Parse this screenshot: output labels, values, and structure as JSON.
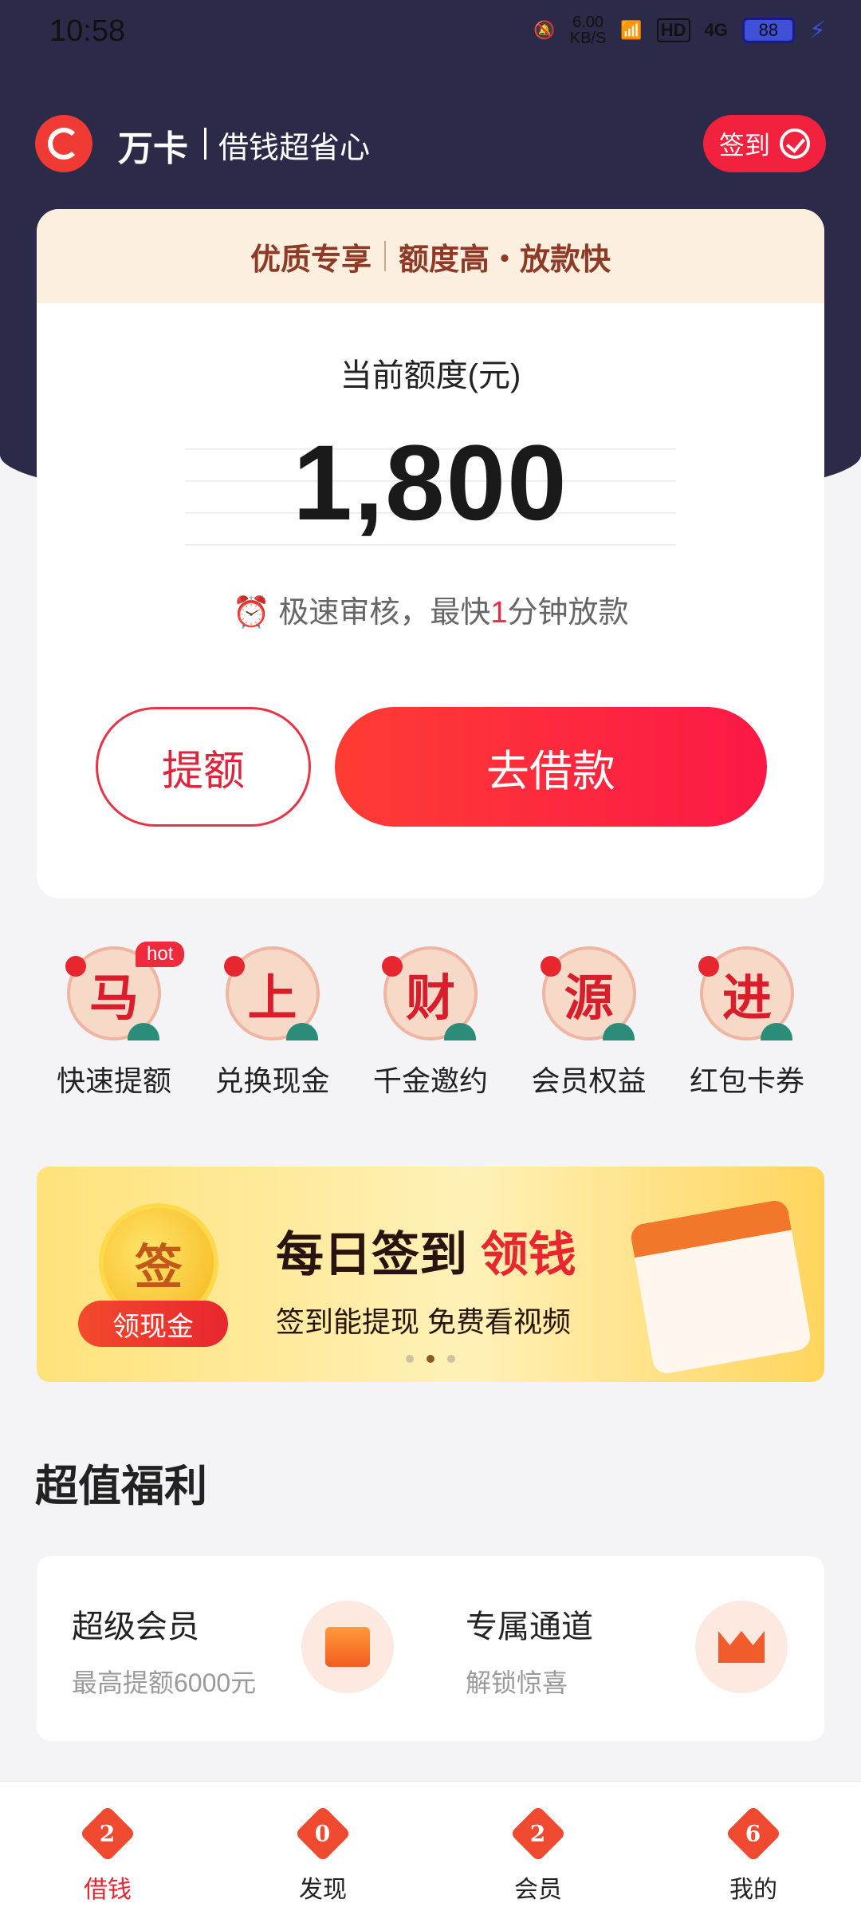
{
  "status": {
    "time": "10:58",
    "speed_value": "6.00",
    "speed_unit": "KB/S",
    "hd": "HD",
    "network": "4G",
    "battery": "88"
  },
  "header": {
    "app_name": "万卡",
    "slogan": "借钱超省心",
    "checkin_label": "签到"
  },
  "card": {
    "banner_left": "优质专享",
    "banner_right": "额度高・放款快",
    "limit_label": "当前额度(元)",
    "amount": "1,800",
    "fast_prefix": "极速审核，最快",
    "fast_num": "1",
    "fast_suffix": "分钟放款",
    "raise_button": "提额",
    "borrow_button": "去借款"
  },
  "quick_actions": [
    {
      "char": "马",
      "label": "快速提额",
      "badge": "hot"
    },
    {
      "char": "上",
      "label": "兑换现金"
    },
    {
      "char": "财",
      "label": "千金邀约"
    },
    {
      "char": "源",
      "label": "会员权益"
    },
    {
      "char": "进",
      "label": "红包卡券"
    }
  ],
  "promo": {
    "coin_char": "签",
    "pill": "领现金",
    "title_black": "每日签到",
    "title_red": "领钱",
    "subtitle": "签到能提现 免费看视频",
    "page_count": 3,
    "active_page": 2
  },
  "section_title": "超值福利",
  "benefits": [
    {
      "title": "超级会员",
      "subtitle": "最高提额6000元",
      "icon": "gift-box-icon"
    },
    {
      "title": "专属通道",
      "subtitle": "解锁惊喜",
      "icon": "crown-icon"
    }
  ],
  "tabs": [
    {
      "label": "借钱",
      "num": "2",
      "active": true
    },
    {
      "label": "发现",
      "num": "0"
    },
    {
      "label": "会员",
      "num": "2"
    },
    {
      "label": "我的",
      "num": "6"
    }
  ],
  "colors": {
    "header_bg": "#2b2a48",
    "accent": "#e8262f",
    "card_head_bg": "#fcefdf"
  }
}
